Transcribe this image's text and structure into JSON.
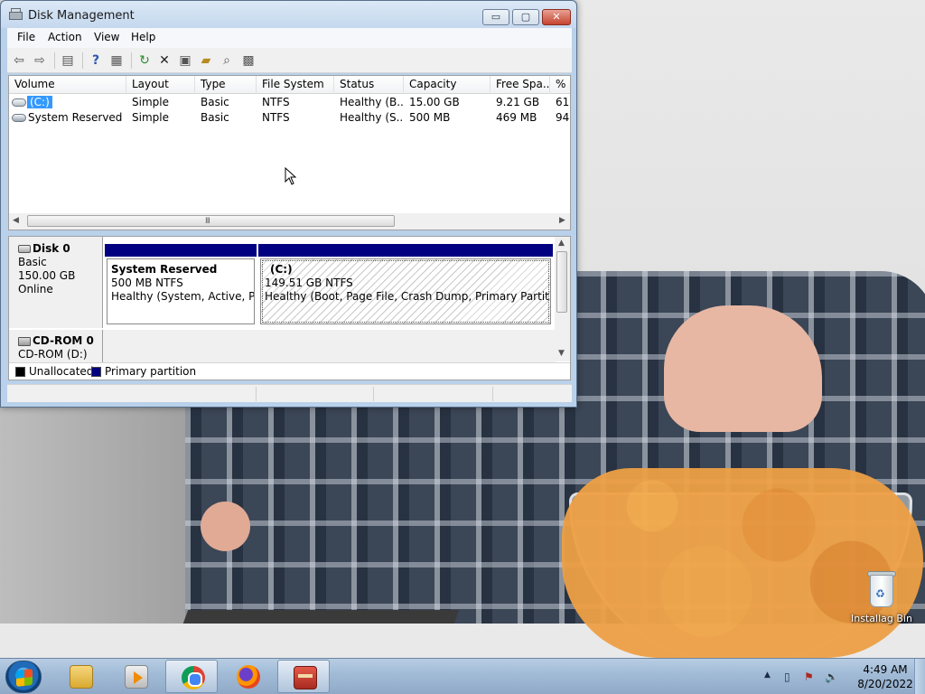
{
  "window": {
    "title": "Disk Management",
    "controls": {
      "minimize": "▭",
      "maximize": "▢",
      "close": "✕"
    }
  },
  "menu": [
    "File",
    "Action",
    "View",
    "Help"
  ],
  "toolbar": [
    {
      "icon": "back-arrow-icon",
      "glyph": "⇦"
    },
    {
      "icon": "forward-arrow-icon",
      "glyph": "⇨"
    },
    {
      "icon": "console-tree-icon",
      "glyph": "▤"
    },
    {
      "icon": "help-icon",
      "glyph": "?"
    },
    {
      "icon": "properties-view-icon",
      "glyph": "▦"
    },
    {
      "icon": "refresh-icon",
      "glyph": "↻"
    },
    {
      "icon": "delete-icon",
      "glyph": "✕"
    },
    {
      "icon": "properties-icon",
      "glyph": "▣"
    },
    {
      "icon": "open-folder-icon",
      "glyph": "▰"
    },
    {
      "icon": "search-icon",
      "glyph": "⌕"
    },
    {
      "icon": "settings-icon",
      "glyph": "▩"
    }
  ],
  "volume_list": {
    "columns": [
      "Volume",
      "Layout",
      "Type",
      "File System",
      "Status",
      "Capacity",
      "Free Spa...",
      "% F"
    ],
    "rows": [
      {
        "volume": "(C:)",
        "layout": "Simple",
        "type": "Basic",
        "fs": "NTFS",
        "status": "Healthy (B...",
        "capacity": "15.00 GB",
        "free": "9.21 GB",
        "pct": "61"
      },
      {
        "volume": "System Reserved",
        "layout": "Simple",
        "type": "Basic",
        "fs": "NTFS",
        "status": "Healthy (S...",
        "capacity": "500 MB",
        "free": "469 MB",
        "pct": "94"
      }
    ],
    "scroll_grip": "III"
  },
  "disks": [
    {
      "title": "Disk 0",
      "kind": "Basic",
      "size": "150.00 GB",
      "state": "Online",
      "partitions": [
        {
          "name": "System Reserved",
          "size_fs": "500 MB NTFS",
          "status": "Healthy (System, Active, Primary Partition)"
        },
        {
          "name": "(C:)",
          "size_fs": "149.51 GB NTFS",
          "status": "Healthy (Boot, Page File, Crash Dump, Primary Partition)"
        }
      ]
    },
    {
      "title": "CD-ROM 0",
      "kind": "CD-ROM (D:)"
    }
  ],
  "legend": [
    {
      "label": "Unallocated",
      "color": "#000000"
    },
    {
      "label": "Primary partition",
      "color": "#000080"
    }
  ],
  "desktop": {
    "recycle_bin_label": "Installag Bin"
  },
  "taskbar": {
    "apps": [
      "file-explorer",
      "media-player",
      "chrome",
      "firefox",
      "toolbox"
    ],
    "active_app": "toolbox",
    "clock_time": "4:49 AM",
    "clock_date": "8/20/2022"
  },
  "colors": {
    "primary_partition": "#000080",
    "selection": "#3399ff",
    "close_button": "#c7432f"
  }
}
